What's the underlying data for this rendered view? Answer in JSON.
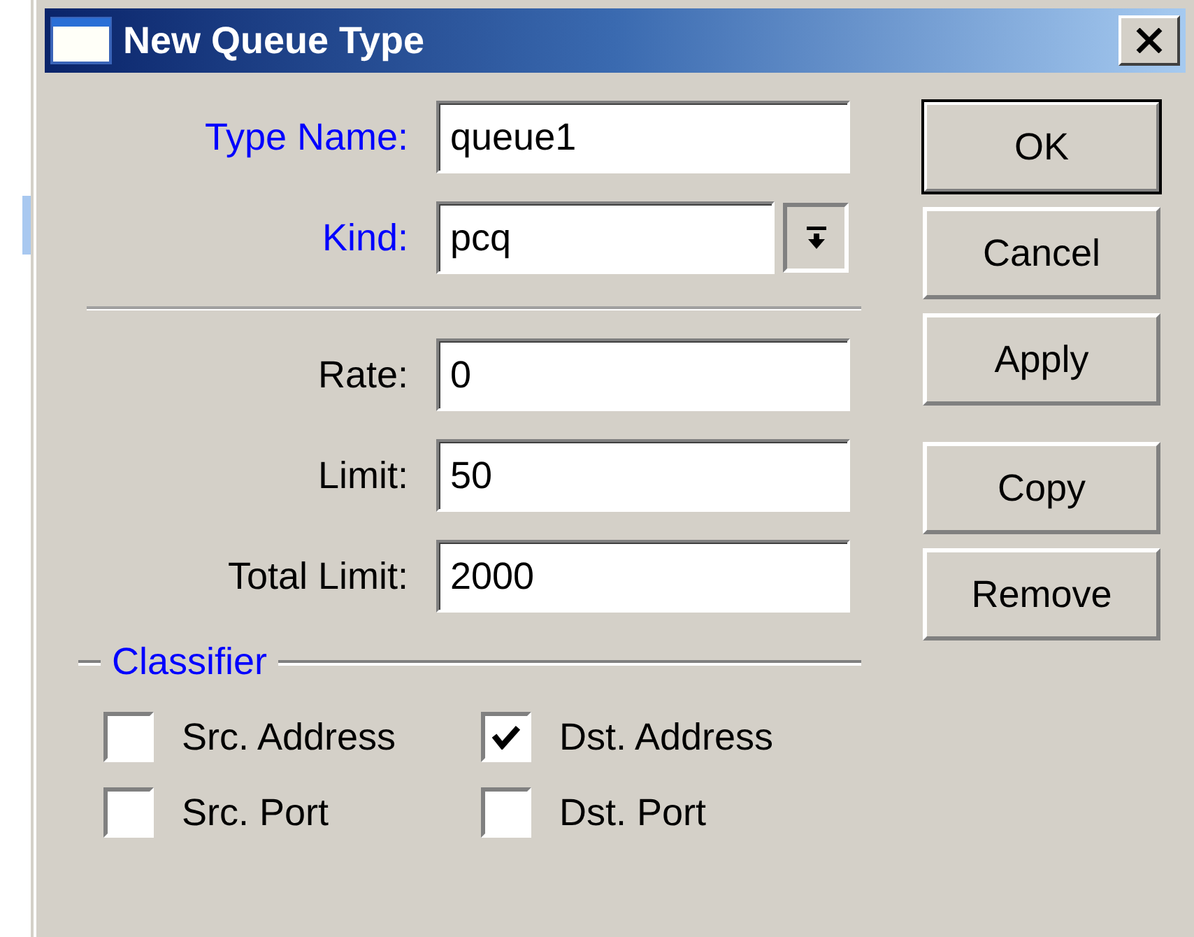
{
  "window": {
    "title": "New Queue Type"
  },
  "fields": [
    {
      "kind": "text",
      "label": "Type Name:",
      "value": "queue1",
      "color": "#0000ff"
    },
    {
      "kind": "dropdown",
      "label": "Kind:",
      "value": "pcq",
      "color": "#0000ff"
    },
    {
      "kind": "separator"
    },
    {
      "kind": "text",
      "label": "Rate:",
      "value": "0",
      "color": "#000000"
    },
    {
      "kind": "text",
      "label": "Limit:",
      "value": "50",
      "color": "#000000"
    },
    {
      "kind": "text",
      "label": "Total Limit:",
      "value": "2000",
      "color": "#000000"
    }
  ],
  "classifier": {
    "title": "Classifier",
    "options": [
      {
        "label": "Src. Address",
        "checked": false
      },
      {
        "label": "Dst. Address",
        "checked": true
      },
      {
        "label": "Src. Port",
        "checked": false
      },
      {
        "label": "Dst. Port",
        "checked": false
      }
    ]
  },
  "button_groups": [
    [
      {
        "label": "OK",
        "default": true
      },
      {
        "label": "Cancel",
        "default": false
      },
      {
        "label": "Apply",
        "default": false
      }
    ],
    [
      {
        "label": "Copy",
        "default": false
      },
      {
        "label": "Remove",
        "default": false
      }
    ]
  ]
}
